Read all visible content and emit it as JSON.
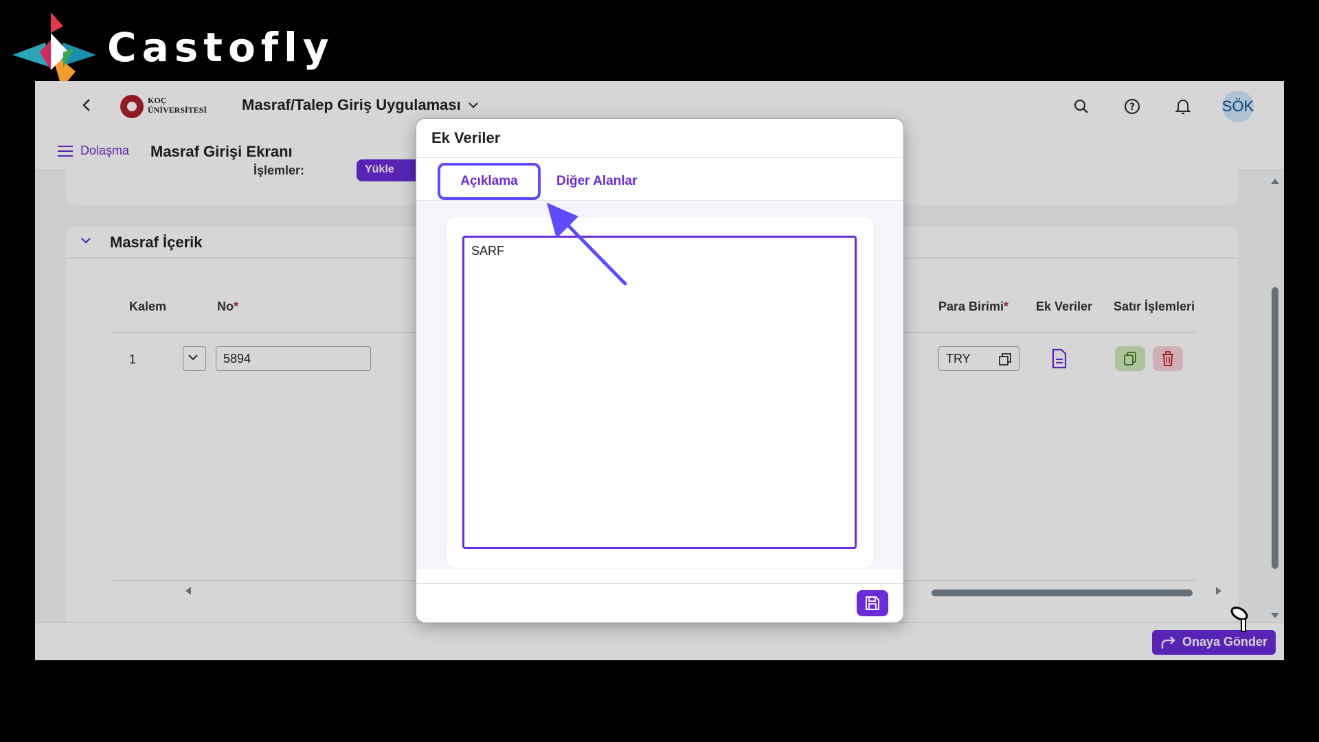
{
  "brand": {
    "name": "Castofly"
  },
  "shell": {
    "logo_line1": "KOÇ",
    "logo_line2": "ÜNİVERSİTESİ",
    "app_title": "Masraf/Talep Giriş Uygulaması",
    "avatar_initials": "SÖK"
  },
  "subheader": {
    "nav_label": "Dolaşma",
    "page_title": "Masraf Girişi Ekranı"
  },
  "top_card": {
    "label": "İşlemler:",
    "upload_label": "Yükle"
  },
  "section": {
    "title": "Masraf İçerik",
    "columns": {
      "kalem": "Kalem",
      "no": "No",
      "para_birimi": "Para Birimi",
      "ek_veriler": "Ek Veriler",
      "satir_islemleri": "Satır İşlemleri"
    },
    "row": {
      "kalem": "1",
      "no_value": "5894",
      "currency": "TRY"
    }
  },
  "footer": {
    "submit_label": "Onaya Gönder"
  },
  "dialog": {
    "title": "Ek Veriler",
    "tabs": [
      {
        "label": "Açıklama",
        "active": true
      },
      {
        "label": "Diğer Alanlar",
        "active": false
      }
    ],
    "description_value": "SARF"
  },
  "colors": {
    "accent": "#6a2bd9",
    "highlight": "#5f4bff",
    "danger": "#c0263b"
  }
}
